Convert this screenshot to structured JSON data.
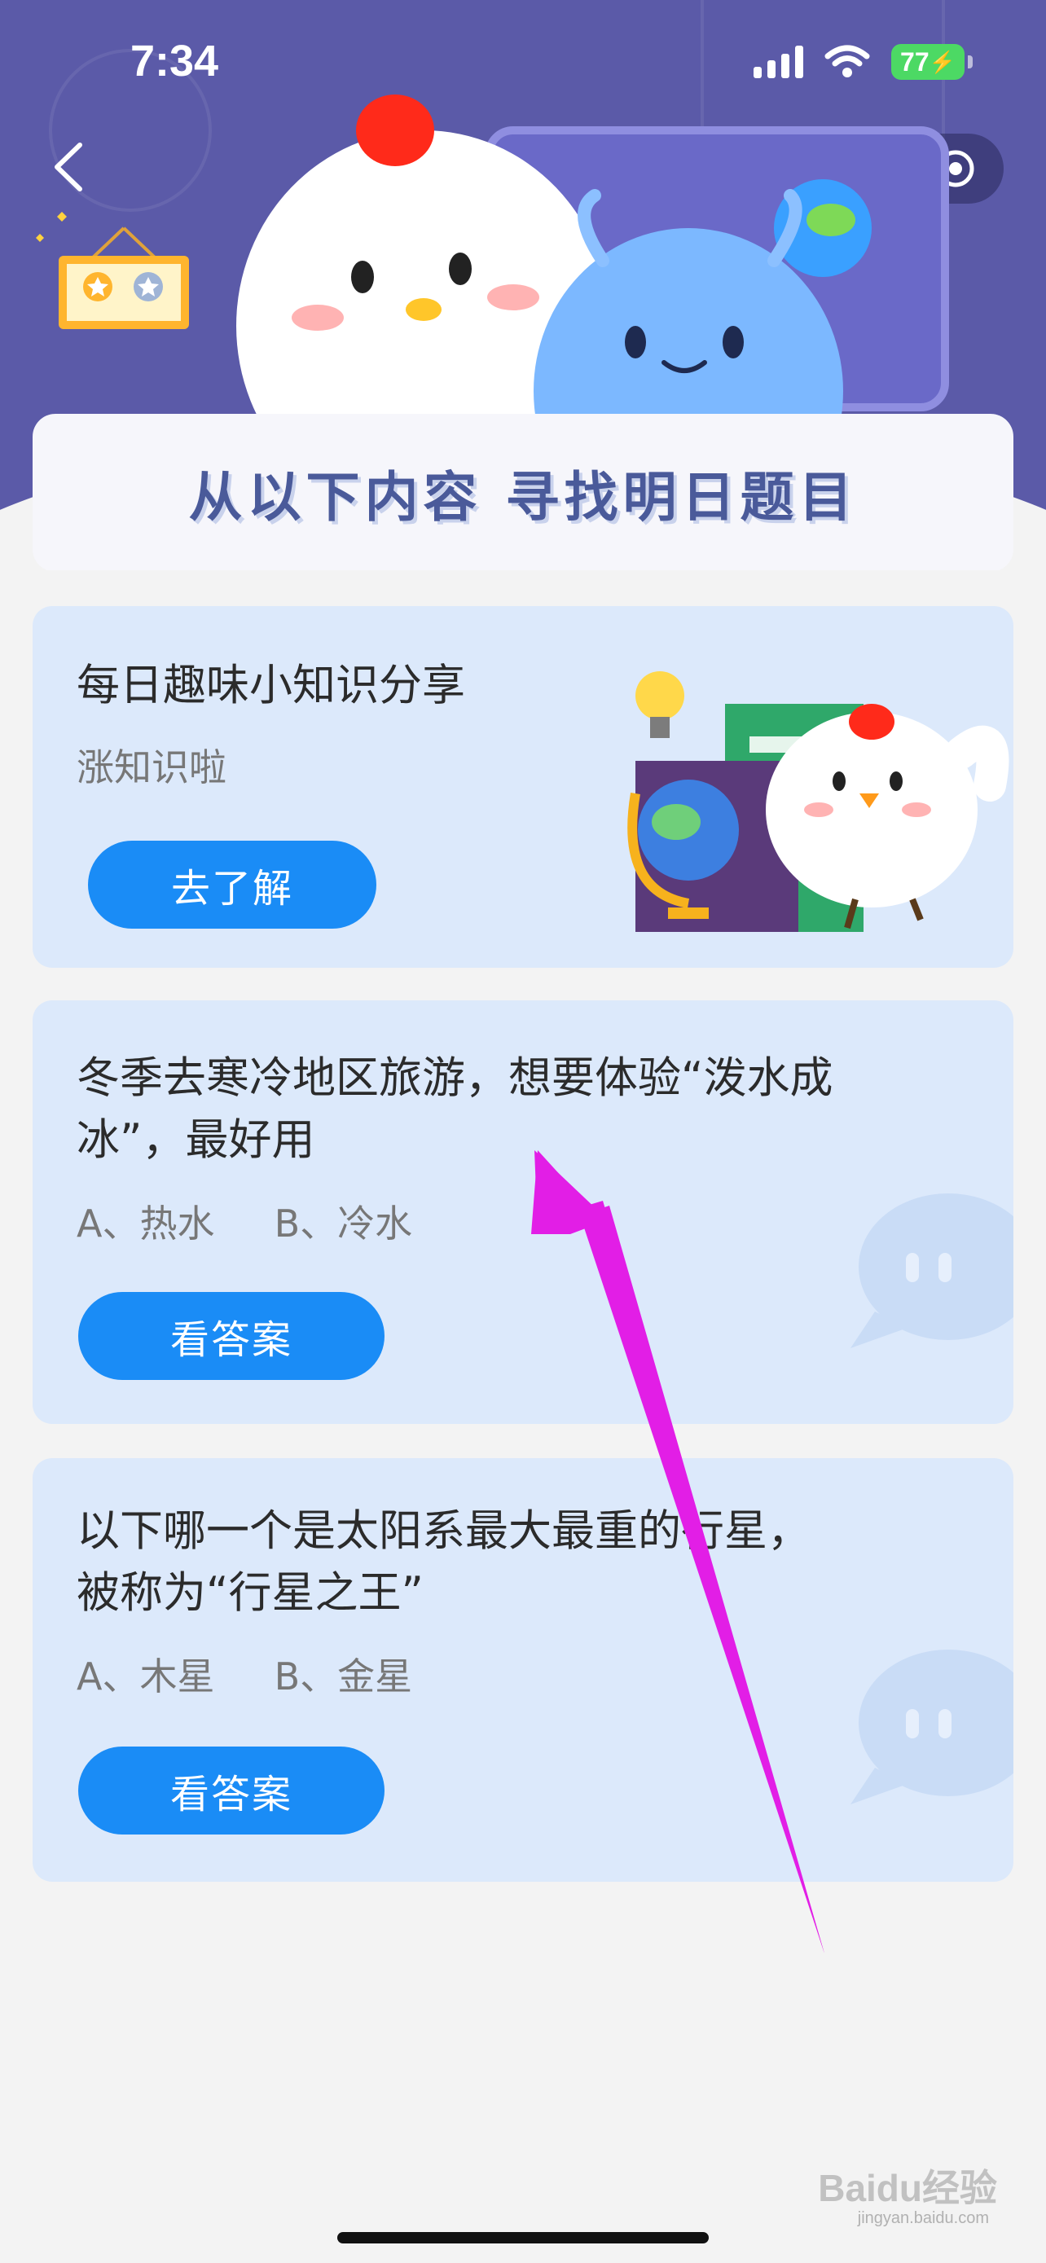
{
  "status_bar": {
    "time": "7:34",
    "battery": "77"
  },
  "banner": {
    "title": "从以下内容 寻找明日题目"
  },
  "knowledge_card": {
    "title": "每日趣味小知识分享",
    "subtitle": "涨知识啦",
    "button_label": "去了解"
  },
  "questions": [
    {
      "line1": "冬季去寒冷地区旅游，想要体验“泼水成",
      "line2": "冰”，最好用",
      "options": "A、热水     B、冷水",
      "button_label": "看答案"
    },
    {
      "line1": "以下哪一个是太阳系最大最重的行星，",
      "line2": "被称为“行星之王”",
      "options": "A、木星     B、金星",
      "button_label": "看答案"
    }
  ],
  "watermark": {
    "text": "Baidu经验",
    "sub": "jingyan.baidu.com"
  },
  "colors": {
    "header": "#5b5aa8",
    "card": "#dce9fb",
    "button": "#1a8cf6",
    "arrow": "#e21ee6"
  },
  "icons": [
    "back-icon",
    "star-icon",
    "more-icon",
    "target-icon",
    "signal-icon",
    "wifi-icon",
    "battery-icon"
  ]
}
